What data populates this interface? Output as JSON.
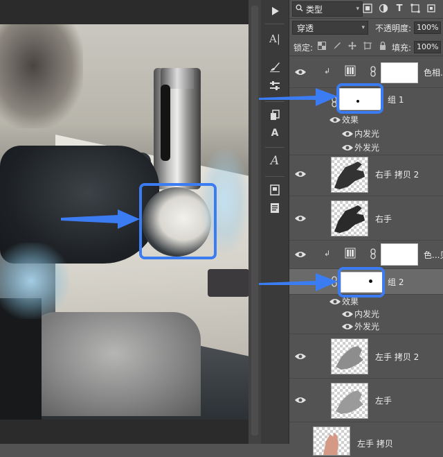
{
  "toolbar": {
    "items": [
      {
        "icon": "play-icon"
      },
      {
        "icon": "character-panel-icon",
        "glyph": "A|"
      },
      {
        "icon": "brush-settings-icon"
      },
      {
        "icon": "adjustments-icon"
      },
      {
        "icon": "layer-comps-icon"
      },
      {
        "icon": "character-style-icon",
        "glyph": "A"
      },
      {
        "icon": "glyph-icon",
        "glyph": "A"
      },
      {
        "icon": "notes-icon"
      },
      {
        "icon": "document-icon"
      }
    ]
  },
  "layers_panel": {
    "filter_label": "类型",
    "blend_mode": "穿透",
    "opacity_label": "不透明度:",
    "opacity_value": "100%",
    "lock_label": "锁定:",
    "fill_label": "填充:",
    "fill_value": "100%",
    "layers": [
      {
        "name": "色相...",
        "kind": "adjustment"
      },
      {
        "name": "组 1",
        "kind": "group-mask",
        "effects_label": "效果",
        "effects": [
          "内发光",
          "外发光"
        ]
      },
      {
        "name": "右手 拷贝 2",
        "kind": "pixel"
      },
      {
        "name": "右手",
        "kind": "pixel"
      },
      {
        "name": "色...贝",
        "kind": "adjustment"
      },
      {
        "name": "组 2",
        "kind": "group-mask",
        "selected": true,
        "effects_label": "效果",
        "effects": [
          "内发光",
          "外发光"
        ]
      },
      {
        "name": "左手 拷贝 2",
        "kind": "pixel"
      },
      {
        "name": "左手",
        "kind": "pixel"
      },
      {
        "name": "左手 拷贝",
        "kind": "pixel"
      }
    ]
  },
  "colors": {
    "annotation_blue": "#3b7cf3",
    "panel_bg": "#535353",
    "toolstrip_bg": "#3a3a3a",
    "selected_layer_bg": "#6a6a6a"
  }
}
